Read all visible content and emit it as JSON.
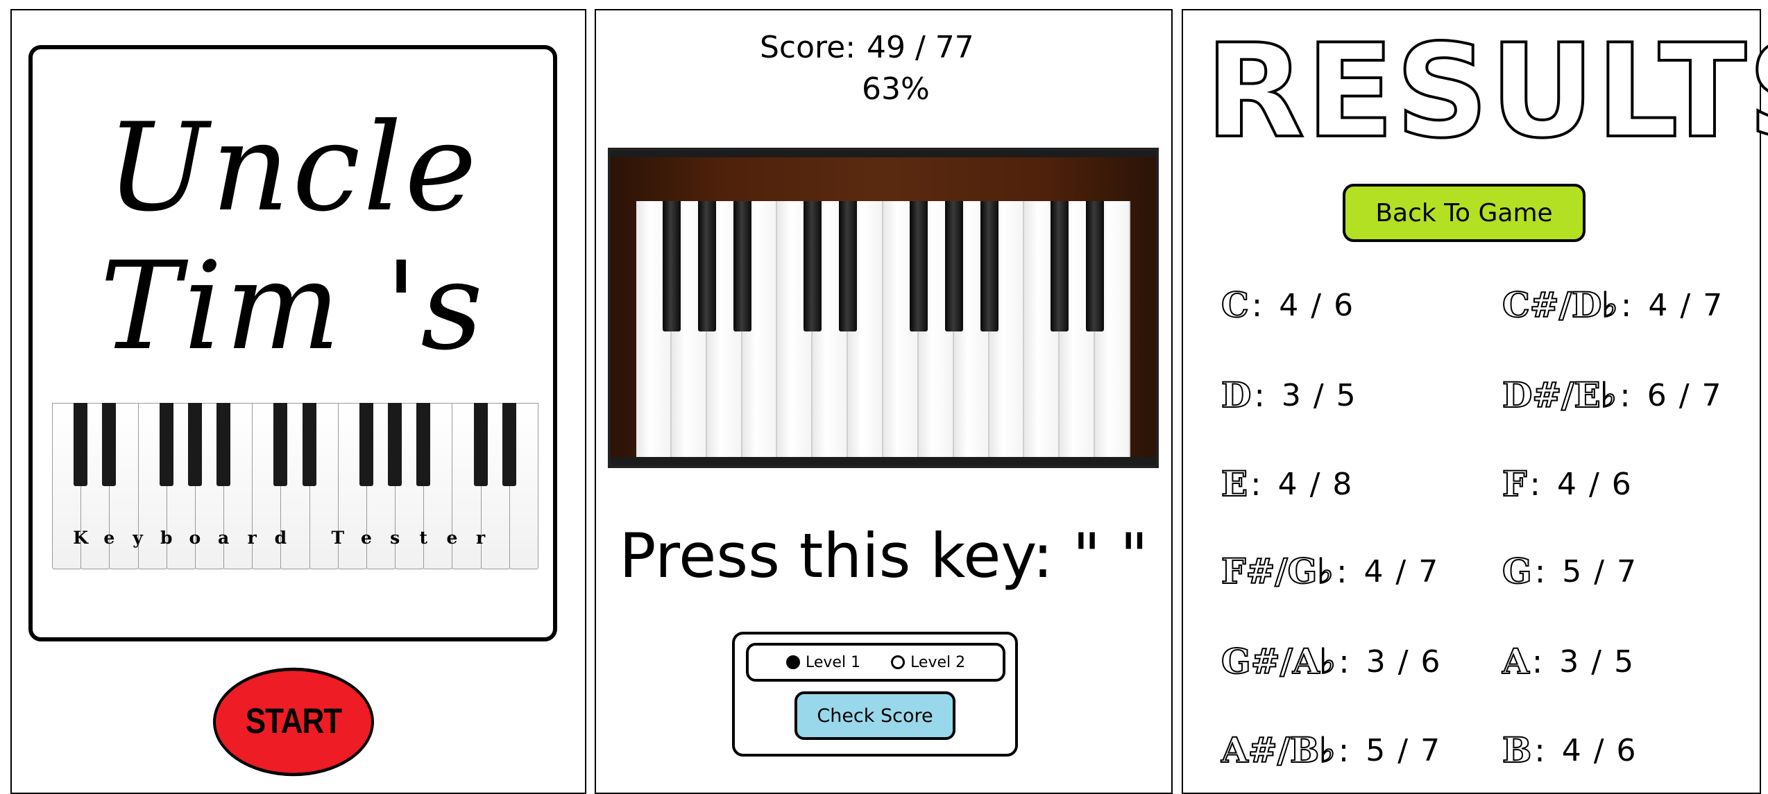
{
  "title_screen": {
    "title_line1": "Uncle",
    "title_line2": "Tim 's",
    "keyboard_letters": [
      "K",
      "e",
      "y",
      "b",
      "o",
      "a",
      "r",
      "d",
      "",
      "T",
      "e",
      "s",
      "t",
      "e",
      "r"
    ],
    "start_label": "START",
    "start_color": "#ee1c24"
  },
  "game_screen": {
    "score_label": "Score:",
    "score_value": "49 / 77",
    "score_percent": "63%",
    "prompt_text": "Press this key: \" \"",
    "levels": [
      {
        "label": "Level 1",
        "selected": true
      },
      {
        "label": "Level 2",
        "selected": false
      }
    ],
    "check_score_label": "Check Score",
    "check_score_color": "#99d8ea"
  },
  "results_screen": {
    "title": "RESULTS",
    "back_label": "Back To Game",
    "back_color": "#b3e023",
    "items": [
      {
        "note": "C",
        "score": "4 / 6"
      },
      {
        "note": "C#/D♭",
        "score": "4 / 7"
      },
      {
        "note": "D",
        "score": "3 / 5"
      },
      {
        "note": "D#/E♭",
        "score": "6 / 7"
      },
      {
        "note": "E",
        "score": "4 / 8"
      },
      {
        "note": "F",
        "score": "4 / 6"
      },
      {
        "note": "F#/G♭",
        "score": "4 / 7"
      },
      {
        "note": "G",
        "score": "5 / 7"
      },
      {
        "note": "G#/A♭",
        "score": "3 / 6"
      },
      {
        "note": "A",
        "score": "3 / 5"
      },
      {
        "note": "A#/B♭",
        "score": "5 / 7"
      },
      {
        "note": "B",
        "score": "4 / 6"
      }
    ]
  }
}
